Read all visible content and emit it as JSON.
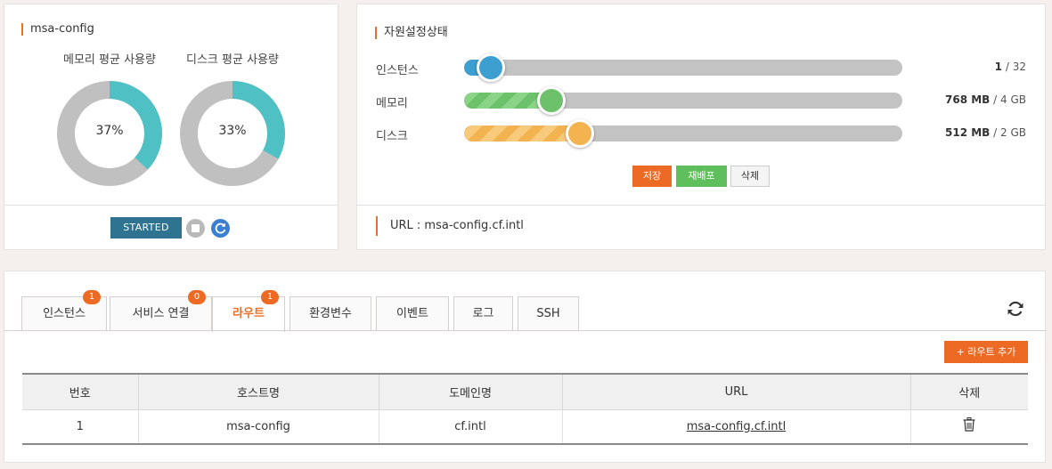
{
  "app": {
    "name": "msa-config",
    "status_button": "STARTED"
  },
  "usage": {
    "memory": {
      "label": "메모리 평균 사용량",
      "percent": 37,
      "percent_text": "37%"
    },
    "disk": {
      "label": "디스크 평균 사용량",
      "percent": 33,
      "percent_text": "33%"
    }
  },
  "resources": {
    "title": "자원설정상태",
    "instances": {
      "label": "인스턴스",
      "current": "1",
      "max": "/ 32",
      "fraction": 0.031
    },
    "memory": {
      "label": "메모리",
      "current": "768 MB",
      "max": "/ 4 GB",
      "fraction": 0.2
    },
    "disk": {
      "label": "디스크",
      "current": "512 MB",
      "max": "/ 2 GB",
      "fraction": 0.265
    },
    "buttons": {
      "save": "저장",
      "redeploy": "재배포",
      "delete": "삭제"
    },
    "url_line": "URL : msa-config.cf.intl"
  },
  "tabs": [
    {
      "label": "인스턴스",
      "badge": "1"
    },
    {
      "label": "서비스 연결",
      "badge": "0"
    },
    {
      "label": "라우트",
      "badge": "1",
      "active": true
    },
    {
      "label": "환경변수"
    },
    {
      "label": "이벤트"
    },
    {
      "label": "로그"
    },
    {
      "label": "SSH"
    }
  ],
  "routes": {
    "add_button": "+ 라우트 추가",
    "columns": [
      "번호",
      "호스트명",
      "도메인명",
      "URL",
      "삭제"
    ],
    "rows": [
      {
        "no": "1",
        "host": "msa-config",
        "domain": "cf.intl",
        "url": "msa-config.cf.intl"
      }
    ]
  },
  "colors": {
    "accent": "#ec6a24",
    "donut_fill": "#4fc1c4",
    "donut_track": "#c0c0c0",
    "started": "#2e7491"
  },
  "icons": [
    "stop-icon",
    "restart-icon",
    "refresh-icon",
    "trash-icon"
  ]
}
